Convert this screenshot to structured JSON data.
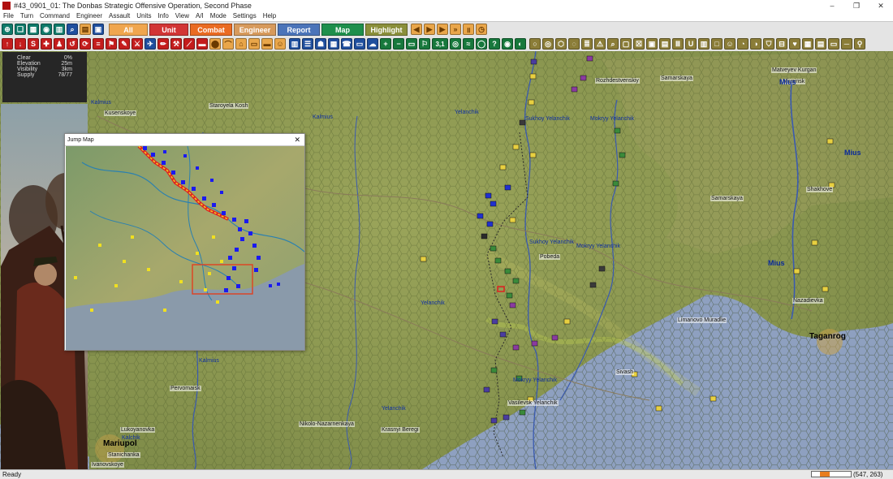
{
  "window": {
    "title": "#43_0901_01: The Donbas Strategic Offensive Operation, Second Phase",
    "controls": [
      "–",
      "❐",
      "✕"
    ]
  },
  "menu": [
    "File",
    "Turn",
    "Command",
    "Engineer",
    "Assault",
    "Units",
    "Info",
    "View",
    "A/I",
    "Mode",
    "Settings",
    "Help"
  ],
  "toolbar1": {
    "modes": [
      {
        "label": "All",
        "color": "#f0a64e",
        "text": "#ffffff"
      },
      {
        "label": "Unit",
        "color": "#d23535",
        "text": "#ffffff"
      },
      {
        "label": "Combat",
        "color": "#ea6b22",
        "text": "#ffffff"
      },
      {
        "label": "Engineer",
        "color": "#d79a5c",
        "text": "#ffffff"
      },
      {
        "label": "Report",
        "color": "#4b74b9",
        "text": "#ffffff"
      },
      {
        "label": "Map",
        "color": "#1e8f4c",
        "text": "#ffffff"
      },
      {
        "label": "Highlight",
        "color": "#8a8f3a",
        "text": "#ffffff"
      }
    ]
  },
  "toolbar2": {
    "counter_label": "3,1",
    "question_label": "?"
  },
  "terrain_info": {
    "rows": [
      {
        "label": "Clear",
        "value": "0%"
      },
      {
        "label": "Elevation",
        "value": "25m"
      },
      {
        "label": "Visibility",
        "value": "3km"
      },
      {
        "label": "Supply",
        "value": "78/77"
      }
    ]
  },
  "jump_map": {
    "title": "Jump Map",
    "close": "✕"
  },
  "map_labels": {
    "rivers": [
      "Yelanchik",
      "Sukhoy Yelanchik",
      "Mokryy Yelanchik",
      "Sukhoy Yelanchik",
      "Mokryy Yelanchik",
      "Yelanchik",
      "Mokryy Yelanchik",
      "Yelanchik",
      "Kalmius",
      "Kalmius",
      "Kalchik",
      "Kalmius"
    ],
    "towns": [
      "Rozhdestvenskiy",
      "Samarskaya",
      "Matveyev Kurgan",
      "Samarskaya",
      "Shakhove",
      "Staroyela Kosh",
      "Kusenskoye",
      "Pobeda",
      "Nazadievka",
      "Vasilevsk Yelanchik",
      "Nikolo-Nazarnenkaya",
      "Pervomaisk",
      "Krasnyi Beregi",
      "Limanovo Muradlie",
      "Sivash",
      "Stanichanka",
      "Ivanovskoye",
      "Lukoyanovka"
    ],
    "cities": [
      "Taganrog",
      "Mariupol",
      "Miusinsk"
    ],
    "mius": [
      "Mius",
      "Mius",
      "Mius"
    ]
  },
  "status_bar": {
    "text": "Ready",
    "coords": "(547, 263)",
    "zoom_level": 0.3
  }
}
